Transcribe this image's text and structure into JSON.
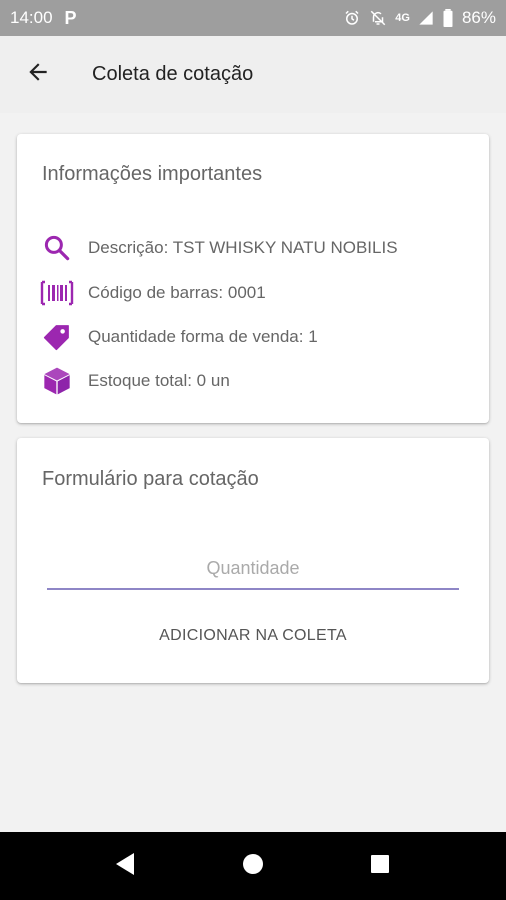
{
  "status_bar": {
    "time": "14:00",
    "notification": "P",
    "network": "4G",
    "battery": "86%"
  },
  "app_bar": {
    "title": "Coleta de cotação",
    "back_icon": "arrow-back-icon"
  },
  "info_card": {
    "title": "Informações importantes",
    "items": [
      {
        "icon": "search-icon",
        "text": "Descrição: TST WHISKY NATU NOBILIS"
      },
      {
        "icon": "barcode-icon",
        "text": "Código de barras: 0001"
      },
      {
        "icon": "tag-icon",
        "text": "Quantidade forma de venda: 1"
      },
      {
        "icon": "box-icon",
        "text": "Estoque total: 0 un"
      }
    ]
  },
  "form_card": {
    "title": "Formulário para cotação",
    "quantity_placeholder": "Quantidade",
    "quantity_value": "",
    "add_button": "ADICIONAR NA COLETA"
  },
  "colors": {
    "accent": "#9c27b0",
    "input_underline": "#8e86c6",
    "status_bar": "#9e9e9e",
    "nav_bar": "#000000"
  }
}
